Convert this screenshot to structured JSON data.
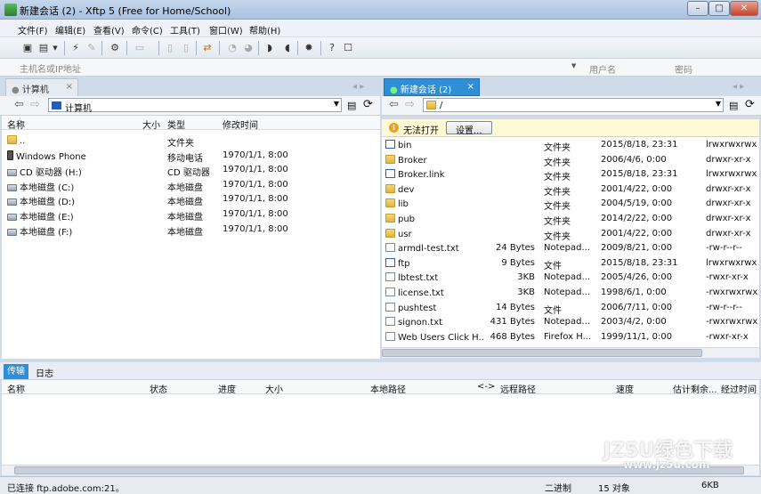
{
  "window": {
    "title": "新建会话 (2)   - Xftp 5 (Free for Home/School)",
    "buttons": {
      "minimize": "–",
      "maximize": "□",
      "close": "✕"
    }
  },
  "menu": [
    "文件(F)",
    "编辑(E)",
    "查看(V)",
    "命令(C)",
    "工具(T)",
    "窗口(W)",
    "帮助(H)"
  ],
  "address": {
    "host_placeholder": "主机名或IP地址",
    "user_placeholder": "用户名",
    "password_placeholder": "密码"
  },
  "left": {
    "tab": "计算机",
    "path": "计算机",
    "headers": {
      "name": "名称",
      "size": "大小",
      "type": "类型",
      "modified": "修改时间"
    },
    "rows": [
      {
        "icon": "folder",
        "name": "..",
        "size": "",
        "type": "文件夹",
        "modified": ""
      },
      {
        "icon": "phone",
        "name": "Windows Phone",
        "size": "",
        "type": "移动电话",
        "modified": "1970/1/1, 8:00"
      },
      {
        "icon": "drive",
        "name": "CD 驱动器 (H:)",
        "size": "",
        "type": "CD 驱动器",
        "modified": "1970/1/1, 8:00"
      },
      {
        "icon": "drive",
        "name": "本地磁盘 (C:)",
        "size": "",
        "type": "本地磁盘",
        "modified": "1970/1/1, 8:00"
      },
      {
        "icon": "drive",
        "name": "本地磁盘 (D:)",
        "size": "",
        "type": "本地磁盘",
        "modified": "1970/1/1, 8:00"
      },
      {
        "icon": "drive",
        "name": "本地磁盘 (E:)",
        "size": "",
        "type": "本地磁盘",
        "modified": "1970/1/1, 8:00"
      },
      {
        "icon": "drive",
        "name": "本地磁盘 (F:)",
        "size": "",
        "type": "本地磁盘",
        "modified": "1970/1/1, 8:00"
      }
    ]
  },
  "right": {
    "tab": "新建会话 (2)",
    "path": "/",
    "warning": "无法打开",
    "settings_button": "设置...",
    "rows": [
      {
        "icon": "link",
        "name": "bin",
        "size": "",
        "type": "文件夹",
        "modified": "2015/8/18, 23:31",
        "perm": "lrwxrwxrwx"
      },
      {
        "icon": "folder",
        "name": "Broker",
        "size": "",
        "type": "文件夹",
        "modified": "2006/4/6, 0:00",
        "perm": "drwxr-xr-x"
      },
      {
        "icon": "link",
        "name": "Broker.link",
        "size": "",
        "type": "文件夹",
        "modified": "2015/8/18, 23:31",
        "perm": "lrwxrwxrwx"
      },
      {
        "icon": "folder",
        "name": "dev",
        "size": "",
        "type": "文件夹",
        "modified": "2001/4/22, 0:00",
        "perm": "drwxr-xr-x"
      },
      {
        "icon": "folder",
        "name": "lib",
        "size": "",
        "type": "文件夹",
        "modified": "2004/5/19, 0:00",
        "perm": "drwxr-xr-x"
      },
      {
        "icon": "folder",
        "name": "pub",
        "size": "",
        "type": "文件夹",
        "modified": "2014/2/22, 0:00",
        "perm": "drwxr-xr-x"
      },
      {
        "icon": "folder",
        "name": "usr",
        "size": "",
        "type": "文件夹",
        "modified": "2001/4/22, 0:00",
        "perm": "drwxr-xr-x"
      },
      {
        "icon": "file",
        "name": "armdl-test.txt",
        "size": "24 Bytes",
        "type": "Notepad...",
        "modified": "2009/8/21, 0:00",
        "perm": "-rw-r--r--"
      },
      {
        "icon": "link",
        "name": "ftp",
        "size": "9 Bytes",
        "type": "文件",
        "modified": "2015/8/18, 23:31",
        "perm": "lrwxrwxrwx"
      },
      {
        "icon": "file",
        "name": "lbtest.txt",
        "size": "3KB",
        "type": "Notepad...",
        "modified": "2005/4/26, 0:00",
        "perm": "-rwxr-xr-x"
      },
      {
        "icon": "file",
        "name": "license.txt",
        "size": "3KB",
        "type": "Notepad...",
        "modified": "1998/6/1, 0:00",
        "perm": "-rwxrwxrwx"
      },
      {
        "icon": "file",
        "name": "pushtest",
        "size": "14 Bytes",
        "type": "文件",
        "modified": "2006/7/11, 0:00",
        "perm": "-rw-r--r--"
      },
      {
        "icon": "file",
        "name": "signon.txt",
        "size": "431 Bytes",
        "type": "Notepad...",
        "modified": "2003/4/2, 0:00",
        "perm": "-rwxrwxrwx"
      },
      {
        "icon": "file",
        "name": "Web Users Click H...",
        "size": "468 Bytes",
        "type": "Firefox H...",
        "modified": "1999/11/1, 0:00",
        "perm": "-rwxr-xr-x"
      }
    ]
  },
  "transfer": {
    "tabs": [
      "传输",
      "日志"
    ],
    "headers": [
      "名称",
      "状态",
      "进度",
      "大小",
      "本地路径",
      "<->",
      "远程路径",
      "速度",
      "估计剩余...",
      "经过时间"
    ]
  },
  "status": {
    "left": "已连接 ftp.adobe.com:21。",
    "mode": "二进制",
    "count": "15 对象",
    "size": "6KB"
  },
  "watermark": {
    "line1": "JZ5U绿色下载",
    "line2": "www.jz5u.com"
  }
}
